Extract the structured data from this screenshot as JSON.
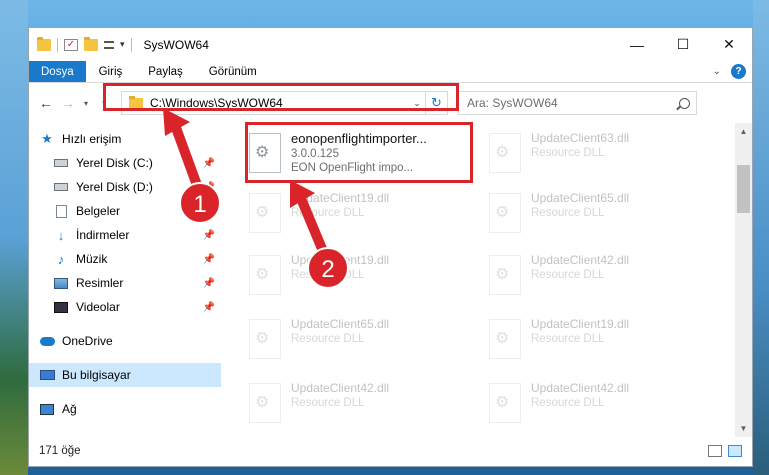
{
  "window": {
    "title": "SysWOW64"
  },
  "ribbon": {
    "tabs": [
      "Dosya",
      "Giriş",
      "Paylaş",
      "Görünüm"
    ]
  },
  "nav": {
    "address": "C:\\Windows\\SysWOW64",
    "search_placeholder": "Ara: SysWOW64"
  },
  "sidebar": {
    "items": [
      {
        "label": "Hızlı erişim"
      },
      {
        "label": "Yerel Disk (C:)"
      },
      {
        "label": "Yerel Disk (D:)"
      },
      {
        "label": "Belgeler"
      },
      {
        "label": "İndirmeler"
      },
      {
        "label": "Müzik"
      },
      {
        "label": "Resimler"
      },
      {
        "label": "Videolar"
      },
      {
        "label": "OneDrive"
      },
      {
        "label": "Bu bilgisayar"
      },
      {
        "label": "Ağ"
      }
    ]
  },
  "files": [
    {
      "name": "eonopenflightimporter...",
      "line2": "3.0.0.125",
      "line3": "EON OpenFlight impo..."
    },
    {
      "name": "UpdateClient63.dll",
      "line2": "Resource DLL"
    },
    {
      "name": "UpdateClient19.dll",
      "line2": "Resource DLL"
    },
    {
      "name": "UpdateClient65.dll",
      "line2": "Resource DLL"
    },
    {
      "name": "UpdateClient19.dll",
      "line2": "Resource DLL"
    },
    {
      "name": "UpdateClient42.dll",
      "line2": "Resource DLL"
    },
    {
      "name": "UpdateClient65.dll",
      "line2": "Resource DLL"
    },
    {
      "name": "UpdateClient19.dll",
      "line2": "Resource DLL"
    },
    {
      "name": "UpdateClient42.dll",
      "line2": "Resource DLL"
    },
    {
      "name": "UpdateClient42.dll",
      "line2": "Resource DLL"
    }
  ],
  "annotations": {
    "step1": "1",
    "step2": "2",
    "accent": "#d9252a"
  },
  "status": {
    "count": "171 öğe"
  }
}
